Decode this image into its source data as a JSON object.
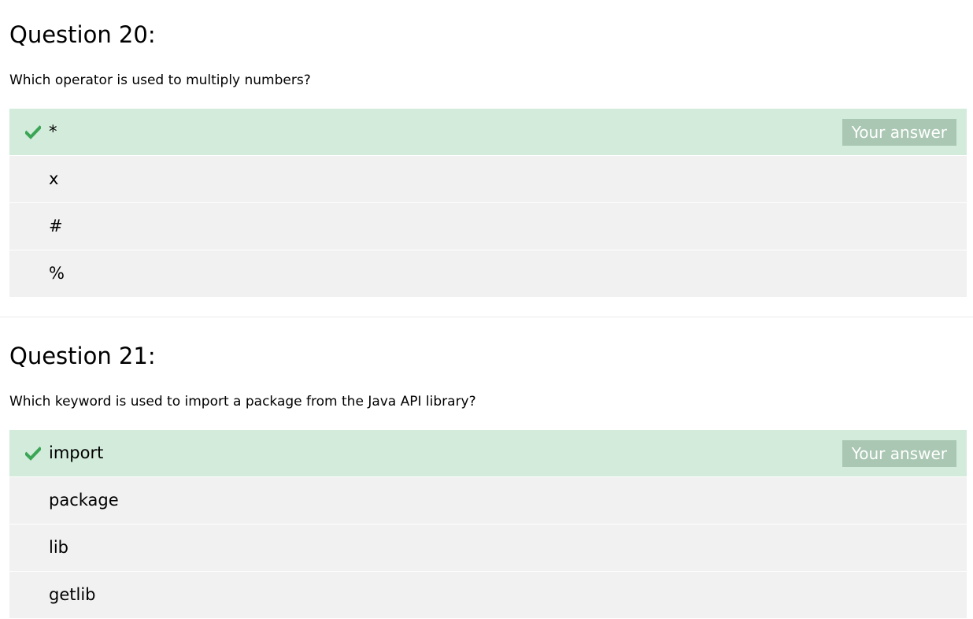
{
  "questions": [
    {
      "title": "Question 20:",
      "text": "Which operator is used to multiply numbers?",
      "options": [
        {
          "label": "*",
          "correct": true,
          "badge": "Your answer"
        },
        {
          "label": "x",
          "correct": false
        },
        {
          "label": "#",
          "correct": false
        },
        {
          "label": "%",
          "correct": false
        }
      ]
    },
    {
      "title": "Question 21:",
      "text": "Which keyword is used to import a package from the Java API library?",
      "options": [
        {
          "label": "import",
          "correct": true,
          "badge": "Your answer"
        },
        {
          "label": "package",
          "correct": false
        },
        {
          "label": "lib",
          "correct": false
        },
        {
          "label": "getlib",
          "correct": false
        }
      ]
    }
  ],
  "icons": {
    "correct": "checkmark-icon"
  },
  "colors": {
    "correct_bg": "#d2ebda",
    "option_bg": "#f1f1f1",
    "check": "#3aa655",
    "badge_bg": "#a9c7b2"
  }
}
